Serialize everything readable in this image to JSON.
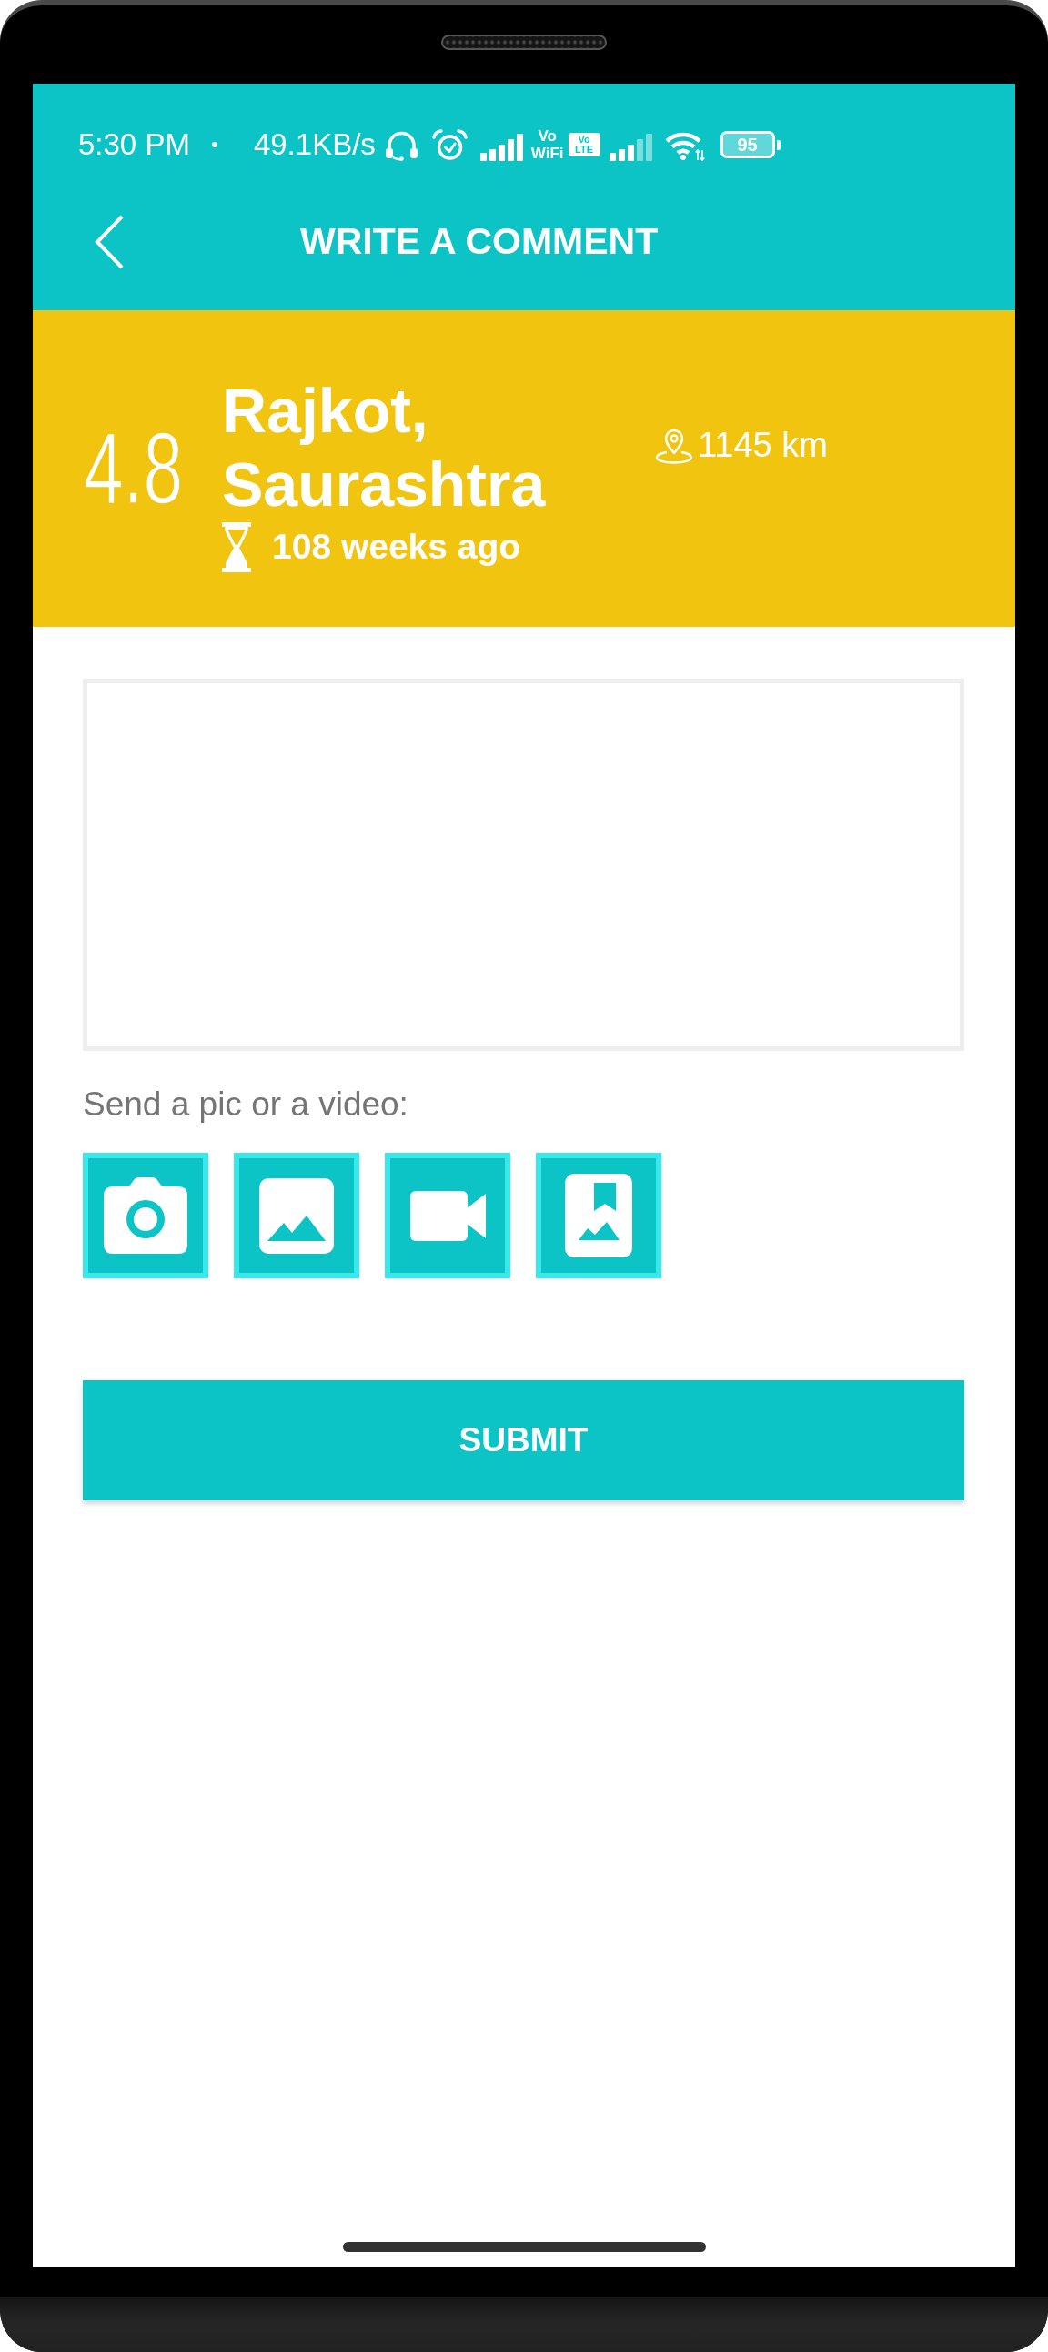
{
  "status_bar": {
    "time": "5:30 PM",
    "network_speed": "49.1KB/s",
    "vowifi_badge": {
      "top": "Vo",
      "bottom": "WiFi"
    },
    "volte_badge": {
      "top": "Vo",
      "bottom": "LTE"
    },
    "battery": "95"
  },
  "app_bar": {
    "title": "WRITE A COMMENT"
  },
  "place": {
    "rating": "4.8",
    "name": "Rajkot, Saurashtra",
    "time_ago": "108 weeks ago",
    "distance": "1145 km"
  },
  "media": {
    "label": "Send a pic or a video:",
    "buttons": [
      {
        "kind": "camera"
      },
      {
        "kind": "gallery"
      },
      {
        "kind": "video"
      },
      {
        "kind": "album"
      }
    ]
  },
  "submit": {
    "label": "SUBMIT"
  }
}
